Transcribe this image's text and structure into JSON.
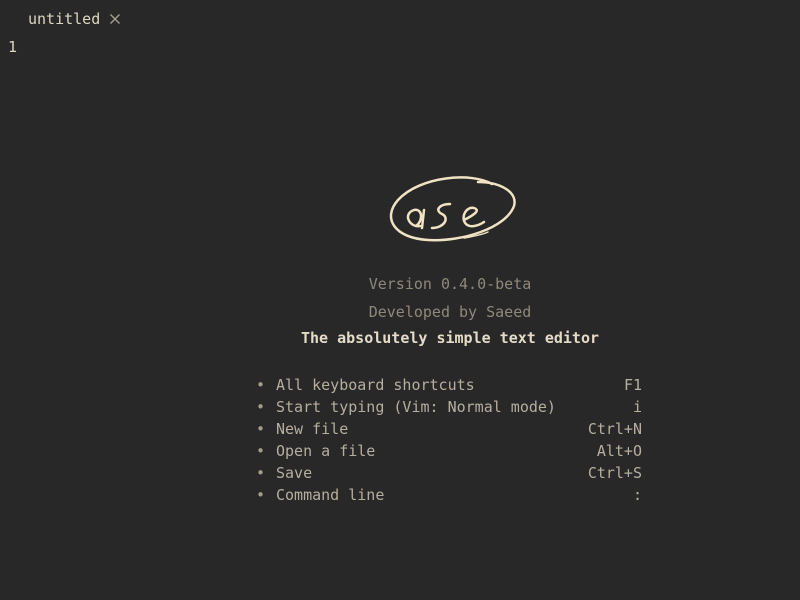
{
  "tabs": [
    {
      "label": "untitled"
    }
  ],
  "editor": {
    "line_numbers": [
      "1"
    ]
  },
  "welcome": {
    "logo_text": "ase",
    "version": "Version 0.4.0-beta",
    "developer": "Developed by Saeed",
    "tagline": "The absolutely simple text editor",
    "shortcuts": [
      {
        "label": "All keyboard shortcuts",
        "key": "F1"
      },
      {
        "label": "Start typing (Vim: Normal mode)",
        "key": "i"
      },
      {
        "label": "New file",
        "key": "Ctrl+N"
      },
      {
        "label": "Open a file",
        "key": "Alt+O"
      },
      {
        "label": "Save",
        "key": "Ctrl+S"
      },
      {
        "label": "Command line",
        "key": ":"
      }
    ]
  },
  "colors": {
    "background": "#282828",
    "text": "#d4cdb8",
    "muted": "#8f887b",
    "accent": "#f0e3c4"
  },
  "icons": {
    "tab_close": "close-icon",
    "bullet": "bullet-icon"
  }
}
